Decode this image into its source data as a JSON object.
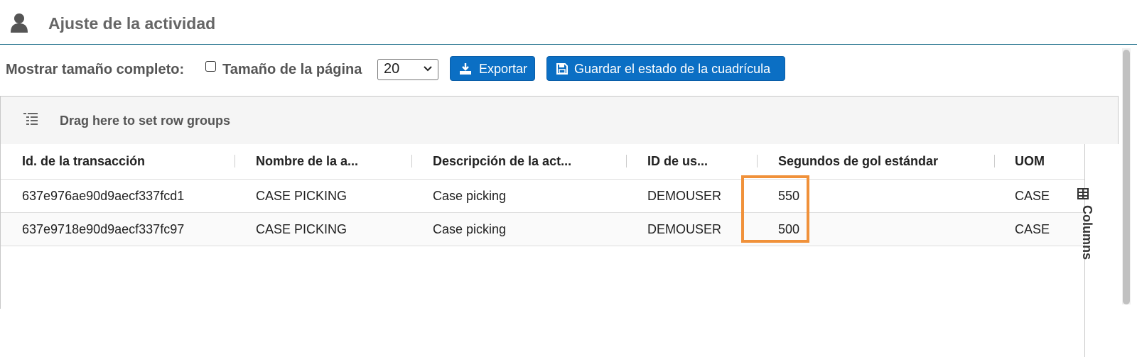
{
  "header": {
    "title": "Ajuste de la actividad",
    "icon": "user-icon"
  },
  "toolbar": {
    "full_size_label": "Mostrar tamaño completo:",
    "full_size_checked": false,
    "page_size_label": "Tamaño de la página",
    "page_size_value": "20",
    "export_label": "Exportar",
    "save_grid_label": "Guardar el estado de la cuadrícula",
    "button_color": "#0b6fc4"
  },
  "grid": {
    "group_bar_text": "Drag here to set row groups",
    "columns_panel_label": "Columns",
    "columns": [
      "Id. de la transacción",
      "Nombre de la a...",
      "Descripción de la act...",
      "ID de us...",
      "Segundos de gol estándar",
      "UOM"
    ],
    "rows": [
      [
        "637e976ae90d9aecf337fcd1",
        "CASE PICKING",
        "Case picking",
        "DEMOUSER",
        "550",
        "CASE"
      ],
      [
        "637e9718e90d9aecf337fc97",
        "CASE PICKING",
        "Case picking",
        "DEMOUSER",
        "500",
        "CASE"
      ]
    ],
    "highlight_color": "#f0913a"
  }
}
